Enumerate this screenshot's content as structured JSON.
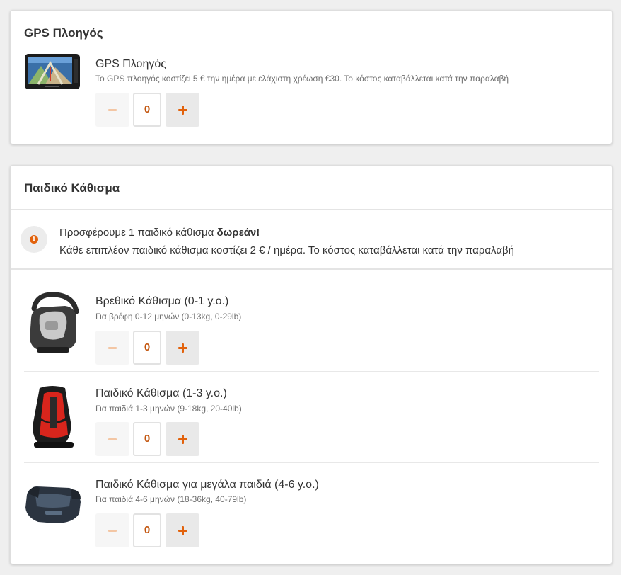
{
  "gps_section": {
    "title": "GPS Πλοηγός",
    "item": {
      "name": "GPS Πλοηγός",
      "description": "Το GPS πλοηγός κοστίζει 5 € την ημέρα με ελάχιστη χρέωση €30. Το κόστος καταβάλλεται κατά την παραλαβή",
      "quantity": "0"
    }
  },
  "child_seat_section": {
    "title": "Παιδικό Κάθισμα",
    "notice": {
      "line1_prefix": "Προσφέρουμε 1 παιδικό κάθισμα ",
      "line1_bold": "δωρεάν!",
      "line2": "Κάθε επιπλέον παιδικό κάθισμα κοστίζει 2 € / ημέρα. Το κόστος καταβάλλεται κατά την παραλαβή",
      "icon": "info-icon"
    },
    "items": [
      {
        "name": "Βρεθικό Κάθισμα (0-1 y.o.)",
        "description": "Για βρέφη 0-12 μηνών (0-13kg, 0-29lb)",
        "quantity": "0"
      },
      {
        "name": "Παιδικό Κάθισμα (1-3 y.o.)",
        "description": "Για παιδιά 1-3 μηνών (9-18kg, 20-40lb)",
        "quantity": "0"
      },
      {
        "name": "Παιδικό Κάθισμα για μεγάλα παιδιά (4-6 y.o.)",
        "description": "Για παιδιά 4-6 μηνών (18-36kg, 40-79lb)",
        "quantity": "0"
      }
    ]
  },
  "colors": {
    "accent": "#e2620c",
    "minus_disabled": "#f3c6a4",
    "page_background": "#efefef"
  }
}
